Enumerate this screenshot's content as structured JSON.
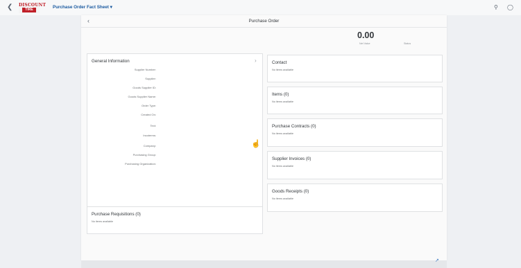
{
  "shell": {
    "back_icon": "chevron-left-icon",
    "logo_top": "DISCOUNT",
    "logo_bottom": "TIRE",
    "app_title": "Purchase Order Fact Sheet ▾",
    "search_icon": "search-icon",
    "user_icon": "user-icon"
  },
  "page": {
    "back_icon": "chevron-left-icon",
    "title": "Purchase Order",
    "kpi_value": "0.00",
    "kpi_label": "Net Value",
    "status_label": "Status"
  },
  "general_info": {
    "title": "General Information",
    "fields": [
      "Supplier Number:",
      "Supplier:",
      "Goods Supplier ID:",
      "Goods Supplier Name:",
      "Order Type:",
      "Created On:",
      "Text:",
      "Incoterms:",
      "Company:",
      "Purchasing Group:",
      "Purchasing Organization:"
    ]
  },
  "purchase_requisitions": {
    "title": "Purchase Requisitions (0)",
    "empty": "No items available"
  },
  "right_cards": [
    {
      "title": "Contact",
      "empty": "No items available"
    },
    {
      "title": "Items (0)",
      "empty": "No items available"
    },
    {
      "title": "Purchase Contracts (0)",
      "empty": "No items available"
    },
    {
      "title": "Supplier Invoices (0)",
      "empty": "No items available"
    },
    {
      "title": "Goods Receipts (0)",
      "empty": "No items available"
    }
  ],
  "colors": {
    "accent": "#1b5aa0",
    "logo_red": "#c01f28",
    "background": "#eef0f3"
  }
}
